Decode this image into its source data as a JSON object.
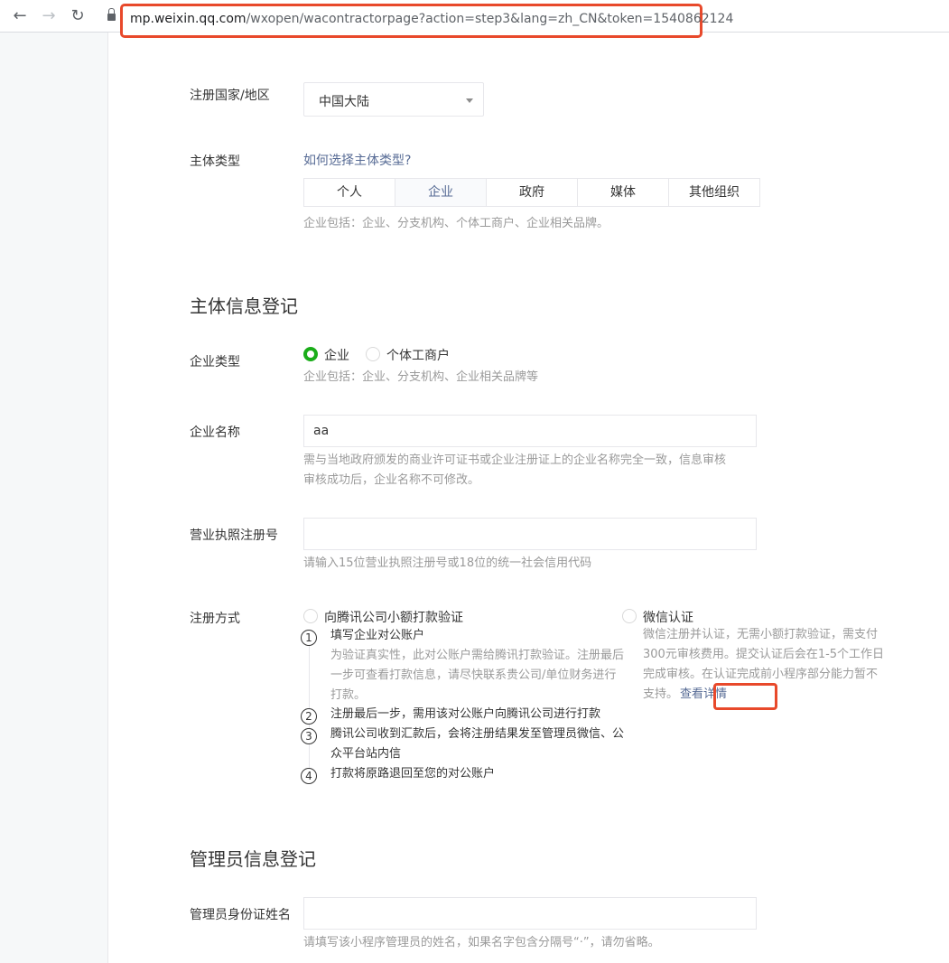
{
  "browser": {
    "url_host": "mp.weixin.qq.com",
    "url_path": "/wxopen/wacontractorpage?action=step3&lang=zh_CN&token=1540862124",
    "back_icon": "arrow-left-icon",
    "forward_icon": "arrow-right-icon",
    "reload_icon": "reload-icon",
    "lock_icon": "lock-icon"
  },
  "colors": {
    "accent_green": "#1aad19",
    "link_blue": "#576b95",
    "highlight_red": "#e8492b"
  },
  "region": {
    "label": "注册国家/地区",
    "selected": "中国大陆"
  },
  "entity": {
    "label": "主体类型",
    "help_link": "如何选择主体类型?",
    "tabs": [
      "个人",
      "企业",
      "政府",
      "媒体",
      "其他组织"
    ],
    "active_tab": "企业",
    "hint": "企业包括：企业、分支机构、个体工商户、企业相关品牌。"
  },
  "info_section": {
    "title": "主体信息登记",
    "company_type": {
      "label": "企业类型",
      "options": [
        "企业",
        "个体工商户"
      ],
      "selected": "企业",
      "hint": "企业包括：企业、分支机构、企业相关品牌等"
    },
    "company_name": {
      "label": "企业名称",
      "value": "aa",
      "hint_line1": "需与当地政府颁发的商业许可证书或企业注册证上的企业名称完全一致，信息审核",
      "hint_line2": "审核成功后，企业名称不可修改。"
    },
    "license": {
      "label": "营业执照注册号",
      "value": "",
      "hint": "请输入15位营业执照注册号或18位的统一社会信用代码"
    },
    "registration": {
      "label": "注册方式",
      "option_transfer": "向腾讯公司小额打款验证",
      "steps": [
        {
          "num": "1",
          "text": "填写企业对公账户",
          "desc": "为验证真实性，此对公账户需给腾讯打款验证。注册最后一步可查看打款信息，请尽快联系贵公司/单位财务进行打款。"
        },
        {
          "num": "2",
          "text": "注册最后一步，需用该对公账户向腾讯公司进行打款"
        },
        {
          "num": "3",
          "text": "腾讯公司收到汇款后，会将注册结果发至管理员微信、公众平台站内信"
        },
        {
          "num": "4",
          "text": "打款将原路退回至您的对公账户"
        }
      ],
      "option_wechat": "微信认证",
      "wechat_desc": "微信注册并认证，无需小额打款验证，需支付300元审核费用。提交认证后会在1-5个工作日完成审核。在认证完成前小程序部分能力暂不支持。",
      "detail_link": "查看详情"
    }
  },
  "admin_section": {
    "title": "管理员信息登记",
    "id_name": {
      "label": "管理员身份证姓名",
      "value": "",
      "hint": "请填写该小程序管理员的姓名，如果名字包含分隔号“·”，请勿省略。"
    }
  }
}
